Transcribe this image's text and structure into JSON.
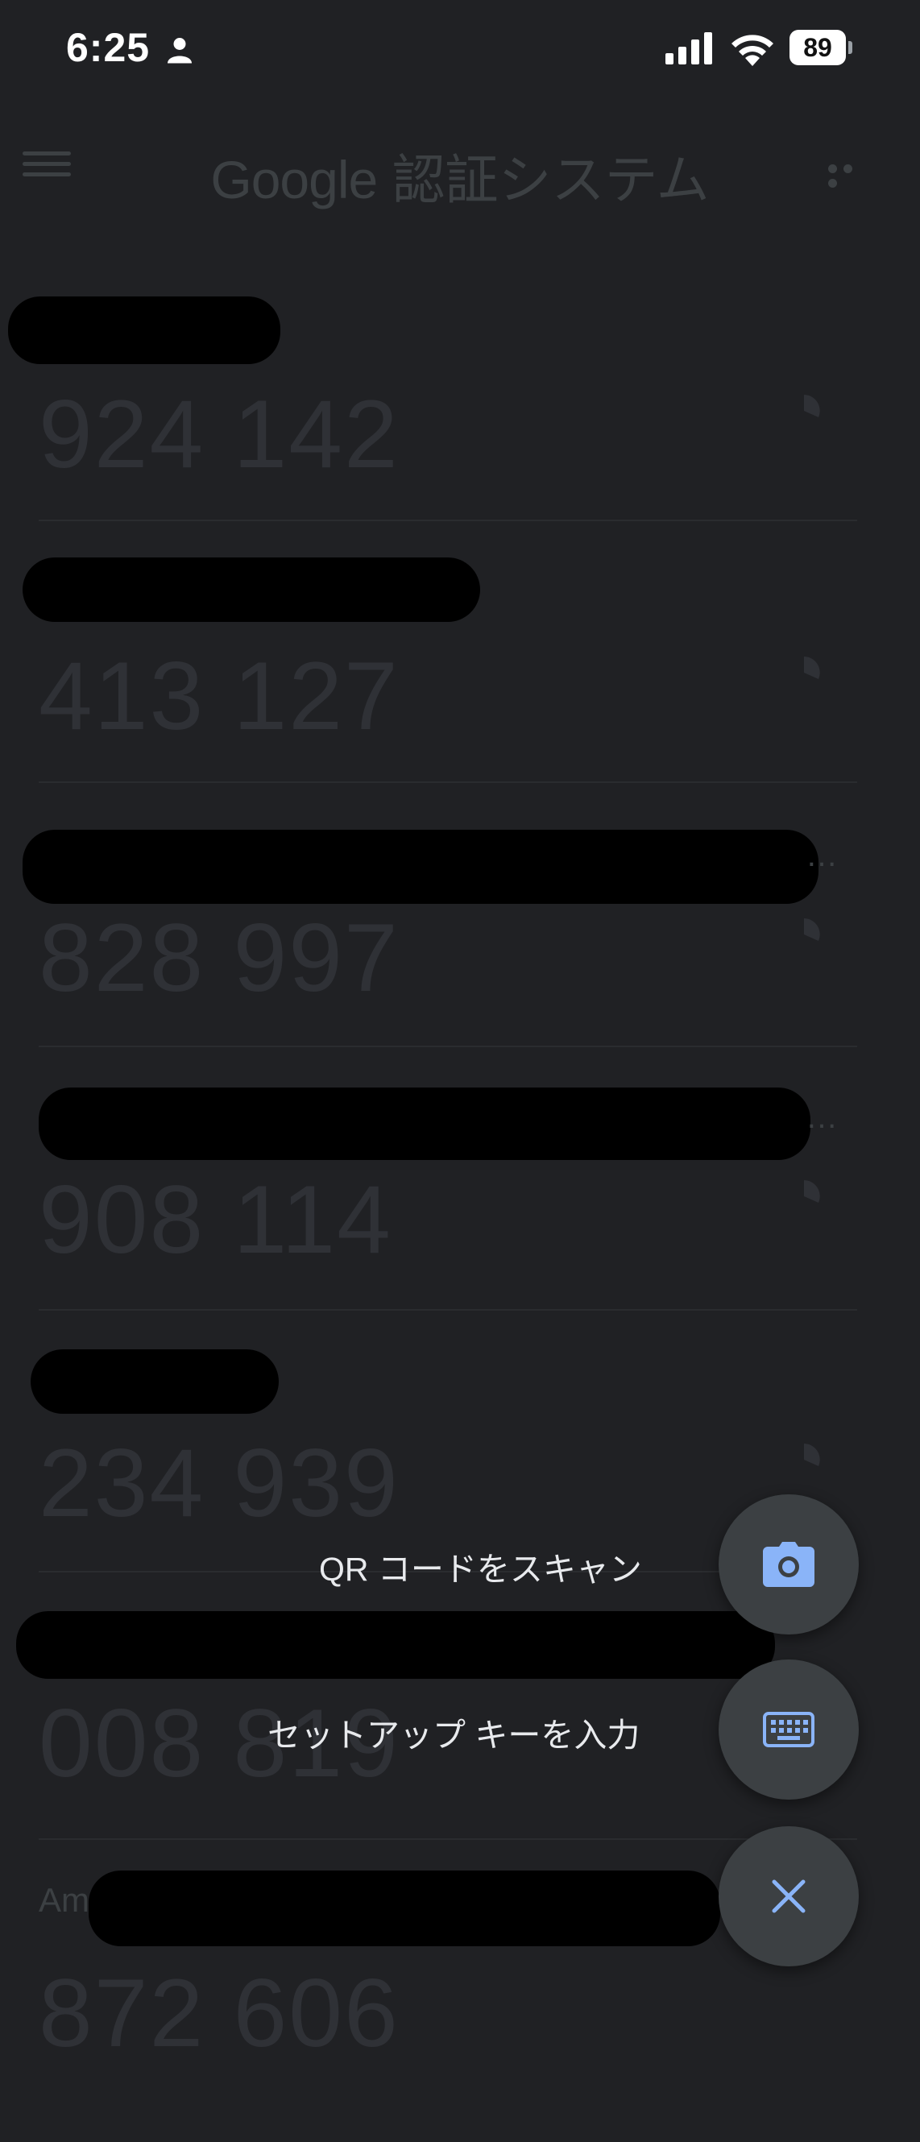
{
  "status_bar": {
    "time": "6:25",
    "battery": "89",
    "icons": [
      "person-icon",
      "signal-icon",
      "wifi-icon",
      "battery-icon"
    ]
  },
  "app_bar": {
    "title_brand": "Google",
    "title_rest": "認証システム",
    "icons": [
      "menu-icon",
      "more-icon"
    ]
  },
  "accounts": [
    {
      "code": "924 142"
    },
    {
      "code": "413 127"
    },
    {
      "code": "828 997"
    },
    {
      "code": "908 114"
    },
    {
      "code": "234 939"
    },
    {
      "code": "008 819"
    },
    {
      "label": "Am",
      "code": "872 606"
    }
  ],
  "fab_menu": {
    "scan_qr_label": "QR コードをスキャン",
    "enter_key_label": "セットアップ キーを入力",
    "icons": [
      "camera-icon",
      "keyboard-icon",
      "close-icon"
    ],
    "accent": "#8ab4f8"
  }
}
